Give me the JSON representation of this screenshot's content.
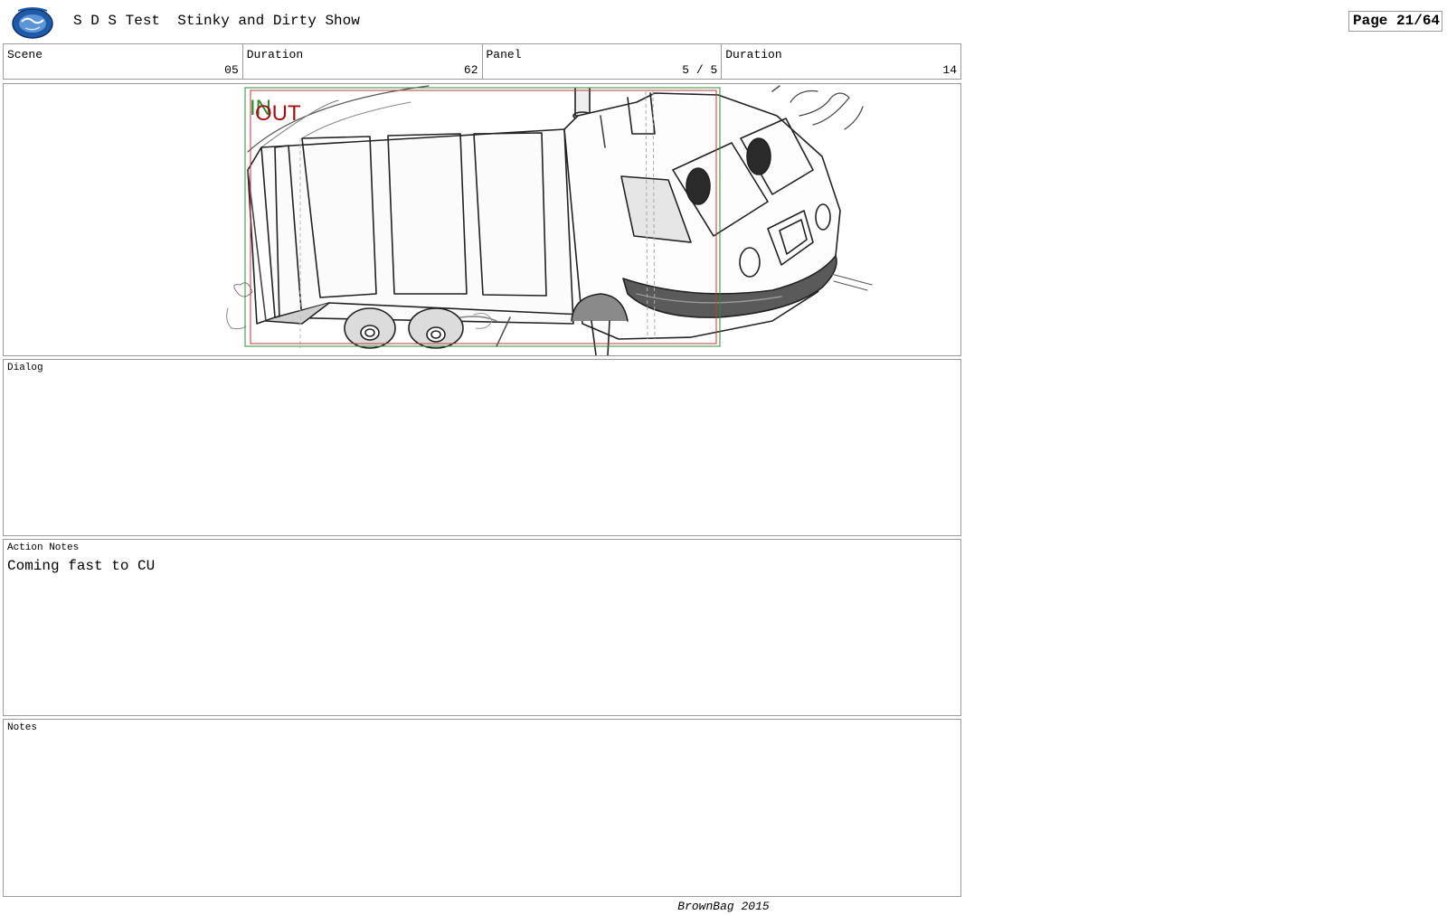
{
  "header": {
    "title": "S D S Test  Stinky and Dirty Show",
    "page": "Page 21/64"
  },
  "info": {
    "scene_label": "Scene",
    "scene_value": "05",
    "duration_label": "Duration",
    "duration_value": "62",
    "panel_label": "Panel",
    "panel_value": "5 / 5",
    "panel_duration_label": "Duration",
    "panel_duration_value": "14"
  },
  "frame": {
    "in_label": "IN",
    "out_label": "OUT",
    "in_color": "#2e8b2e",
    "out_color": "#a01010",
    "subject": "garbage-truck-sketch"
  },
  "sections": {
    "dialog_label": "Dialog",
    "dialog_text": "",
    "action_label": "Action Notes",
    "action_text": "Coming fast to CU",
    "notes_label": "Notes",
    "notes_text": ""
  },
  "footer": {
    "text": "BrownBag 2015"
  }
}
